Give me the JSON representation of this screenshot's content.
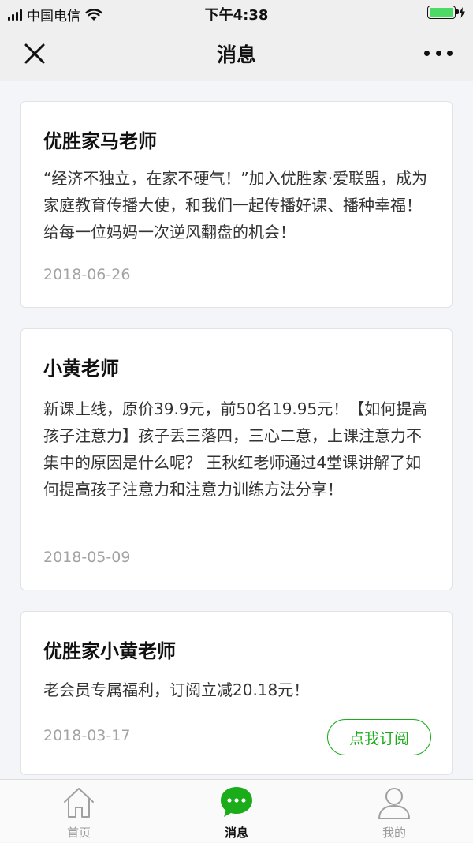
{
  "statusbar": {
    "carrier": "中国电信",
    "time": "下午4:38"
  },
  "navbar": {
    "title": "消息"
  },
  "messages": [
    {
      "sender": "优胜家马老师",
      "body": "“经济不独立，在家不硬气！”加入优胜家·爱联盟，成为家庭教育传播大使，和我们一起传播好课、播种幸福！给每一位妈妈一次逆风翻盘的机会！",
      "date": "2018-06-26"
    },
    {
      "sender": "小黄老师",
      "body": "新课上线，原价39.9元，前50名19.95元！【如何提高孩子注意力】孩子丢三落四，三心二意，上课注意力不集中的原因是什么呢？ 王秋红老师通过4堂课讲解了如何提高孩子注意力和注意力训练方法分享！",
      "date": "2018-05-09"
    },
    {
      "sender": "优胜家小黄老师",
      "body": "老会员专属福利，订阅立减20.18元！",
      "date": "2018-03-17",
      "button": "点我订阅"
    }
  ],
  "tabbar": {
    "tabs": [
      {
        "label": "首页",
        "icon": "home-icon"
      },
      {
        "label": "消息",
        "icon": "chat-bubble-icon",
        "active": true
      },
      {
        "label": "我的",
        "icon": "user-icon"
      }
    ]
  },
  "colors": {
    "accent": "#1aad19",
    "battery": "#4cd964",
    "date_text": "#a3a3a6",
    "background": "#f4f5f8"
  }
}
